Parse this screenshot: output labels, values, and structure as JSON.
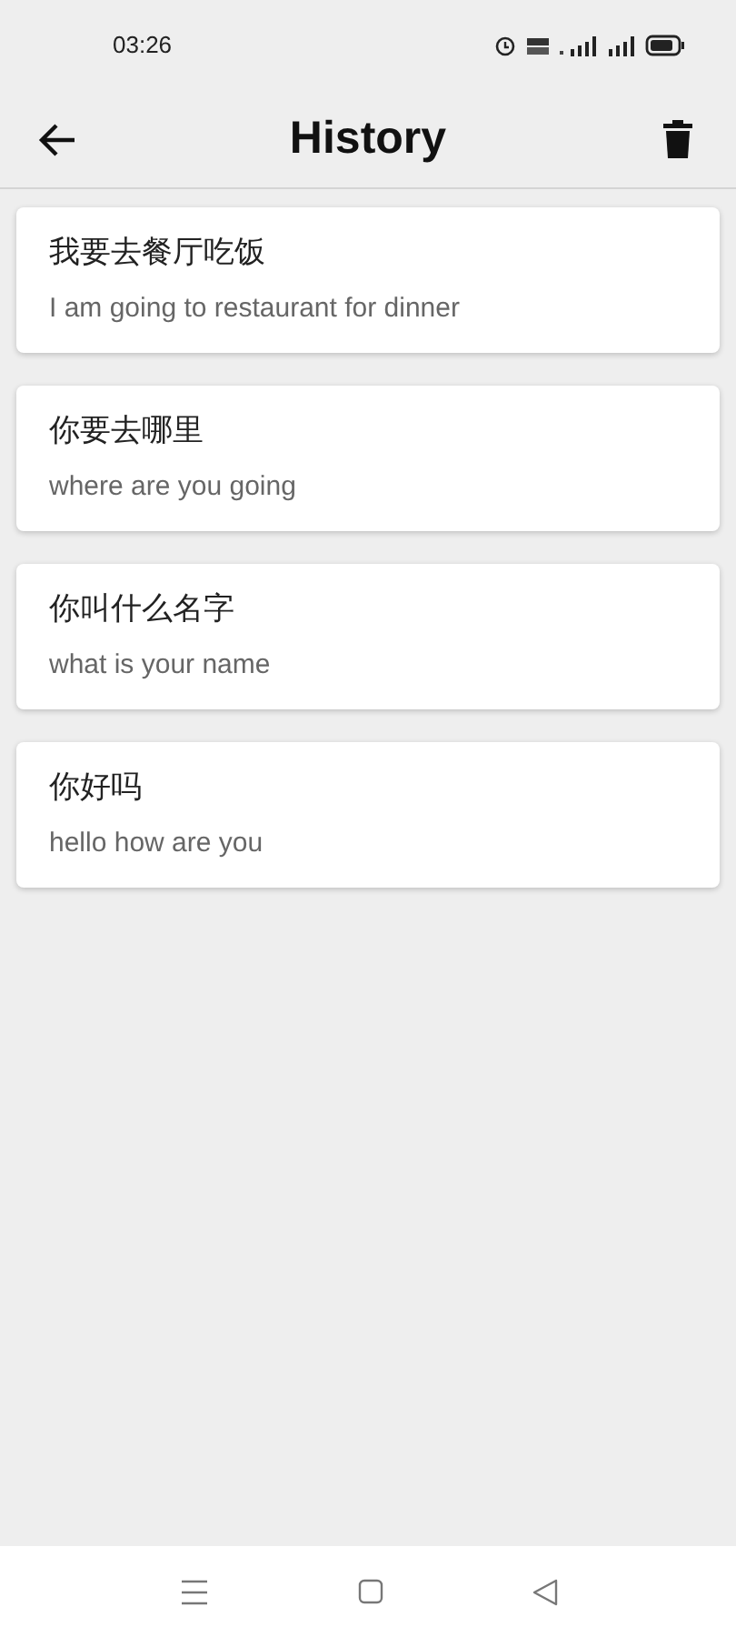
{
  "status_bar": {
    "time": "03:26"
  },
  "app_bar": {
    "title": "History"
  },
  "entries": [
    {
      "source": "我要去餐厅吃饭",
      "translation": "I am going to restaurant for dinner"
    },
    {
      "source": "你要去哪里",
      "translation": "where are you going"
    },
    {
      "source": "你叫什么名字",
      "translation": "what is your name"
    },
    {
      "source": "你好吗",
      "translation": "hello how are you"
    }
  ]
}
